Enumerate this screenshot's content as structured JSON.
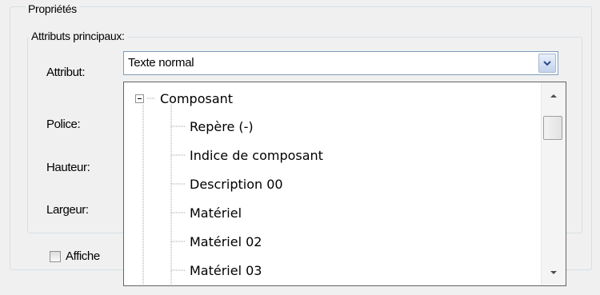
{
  "group": {
    "title": "Propriétés",
    "inner_title": "Attributs principaux:"
  },
  "labels": {
    "attribut": "Attribut:",
    "police": "Police:",
    "hauteur": "Hauteur:",
    "largeur": "Largeur:"
  },
  "combo": {
    "value": "Texte normal"
  },
  "tree": {
    "root": "Composant",
    "items": [
      "Repère (-)",
      "Indice de composant",
      "Description 00",
      "Matériel",
      "Matériel 02",
      "Matériel 03"
    ]
  },
  "checkbox": {
    "label": "Affiche"
  },
  "icons": {
    "combo_arrow": "chevron-down-icon",
    "tree_toggle": "minus-icon",
    "scroll_up": "arrow-up-icon",
    "scroll_down": "arrow-down-icon"
  }
}
